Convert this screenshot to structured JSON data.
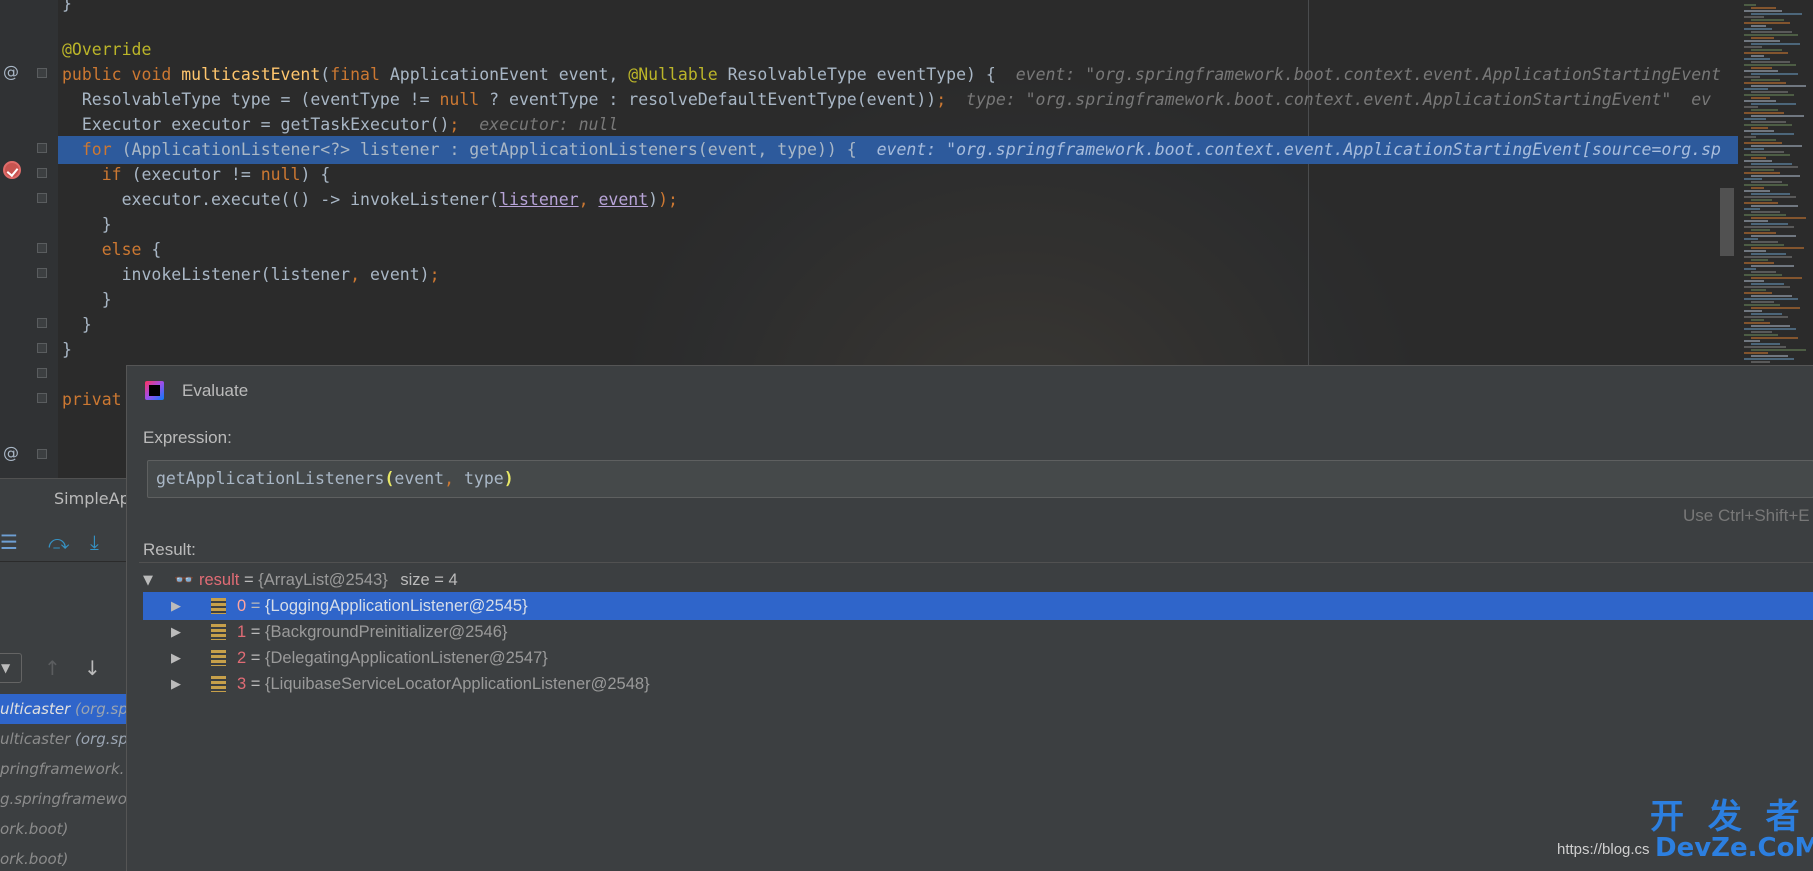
{
  "editor": {
    "gutter_at": "@",
    "lines": [
      {
        "parts": [
          [
            "}",
            ""
          ]
        ]
      },
      {
        "parts": [
          [
            "@Override",
            "ann"
          ]
        ]
      },
      {
        "parts": [
          [
            "public void ",
            "kw"
          ],
          [
            "multicastEvent",
            "fn"
          ],
          [
            "(",
            ""
          ],
          [
            "final ",
            "kw"
          ],
          [
            "ApplicationEvent event, ",
            ""
          ],
          [
            "@Nullable ",
            "ann"
          ],
          [
            "ResolvableType eventType) {",
            ""
          ],
          [
            "  event: \"org.springframework.boot.context.event.ApplicationStartingEvent",
            "hint"
          ]
        ]
      },
      {
        "parts": [
          [
            "  ResolvableType type = (eventType != ",
            ""
          ],
          [
            "null",
            "kw"
          ],
          [
            " ? eventType : resolveDefaultEventType(event))",
            ""
          ],
          [
            ";",
            "kw"
          ],
          [
            "  type: \"org.springframework.boot.context.event.ApplicationStartingEvent\"  ev",
            "hint"
          ]
        ]
      },
      {
        "parts": [
          [
            "  Executor executor = getTaskExecutor()",
            ""
          ],
          [
            ";",
            "kw"
          ],
          [
            "  executor: null",
            "hint"
          ]
        ]
      },
      {
        "parts": [
          [
            "  ",
            ""
          ],
          [
            "for ",
            "kw"
          ],
          [
            "(ApplicationListener<?> listener : getApplicationListeners(event, type)) {",
            ""
          ],
          [
            "  event: \"org.springframework.boot.context.event.ApplicationStartingEvent[source=org.sp",
            "hint-exec"
          ]
        ]
      },
      {
        "parts": [
          [
            "    ",
            ""
          ],
          [
            "if ",
            "kw"
          ],
          [
            "(executor != ",
            ""
          ],
          [
            "null",
            "kw"
          ],
          [
            ") {",
            ""
          ]
        ]
      },
      {
        "parts": [
          [
            "      executor.execute(() -> invokeListener(",
            ""
          ],
          [
            "listener",
            "ul"
          ],
          [
            ", ",
            "kw"
          ],
          [
            "event",
            "ul"
          ],
          [
            ")",
            ""
          ],
          [
            ");",
            "kw"
          ]
        ]
      },
      {
        "parts": [
          [
            "    }",
            ""
          ]
        ]
      },
      {
        "parts": [
          [
            "    ",
            ""
          ],
          [
            "else ",
            "kw"
          ],
          [
            "{",
            ""
          ]
        ]
      },
      {
        "parts": [
          [
            "      invokeListener(listener",
            ""
          ],
          [
            ", ",
            "kw"
          ],
          [
            "event)",
            ""
          ],
          [
            ";",
            "kw"
          ]
        ]
      },
      {
        "parts": [
          [
            "    }",
            ""
          ]
        ]
      },
      {
        "parts": [
          [
            "  }",
            ""
          ]
        ]
      },
      {
        "parts": [
          [
            "}",
            ""
          ]
        ]
      },
      {
        "parts": [
          [
            "",
            ""
          ]
        ]
      },
      {
        "parts": [
          [
            "privat",
            "kw"
          ]
        ]
      }
    ]
  },
  "debug": {
    "tab_label": "SimpleAp",
    "frames": [
      {
        "method": "ulticaster ",
        "pkg": "(org.sp"
      },
      {
        "method": "ulticaster ",
        "pkg": "(org.sp"
      },
      {
        "method": "pringframework.",
        "pkg": ""
      },
      {
        "method": "g.springframewo",
        "pkg": ""
      },
      {
        "method": "ork.boot)",
        "pkg": ""
      },
      {
        "method": "ork.boot)",
        "pkg": ""
      }
    ],
    "dropdown_icon": "▼",
    "up_arrow": "↑",
    "down_arrow": "↓"
  },
  "evaluate": {
    "title": "Evaluate",
    "expression_label": "Expression:",
    "expression_fn": "getApplicationListeners",
    "expression_args": "event, type",
    "expression_comma": ",",
    "hint": "Use Ctrl+Shift+E",
    "result_label": "Result:",
    "result": {
      "name": "result",
      "value": "{ArrayList@2543}",
      "size": "size = 4",
      "items": [
        {
          "index": "0",
          "value": "{LoggingApplicationListener@2545}"
        },
        {
          "index": "1",
          "value": "{BackgroundPreinitializer@2546}"
        },
        {
          "index": "2",
          "value": "{DelegatingApplicationListener@2547}"
        },
        {
          "index": "3",
          "value": "{LiquibaseServiceLocatorApplicationListener@2548}"
        }
      ]
    }
  },
  "watermark": {
    "line1": "开 发 者",
    "line2": "DevZe.CoM",
    "blog": "https://blog.cs"
  }
}
